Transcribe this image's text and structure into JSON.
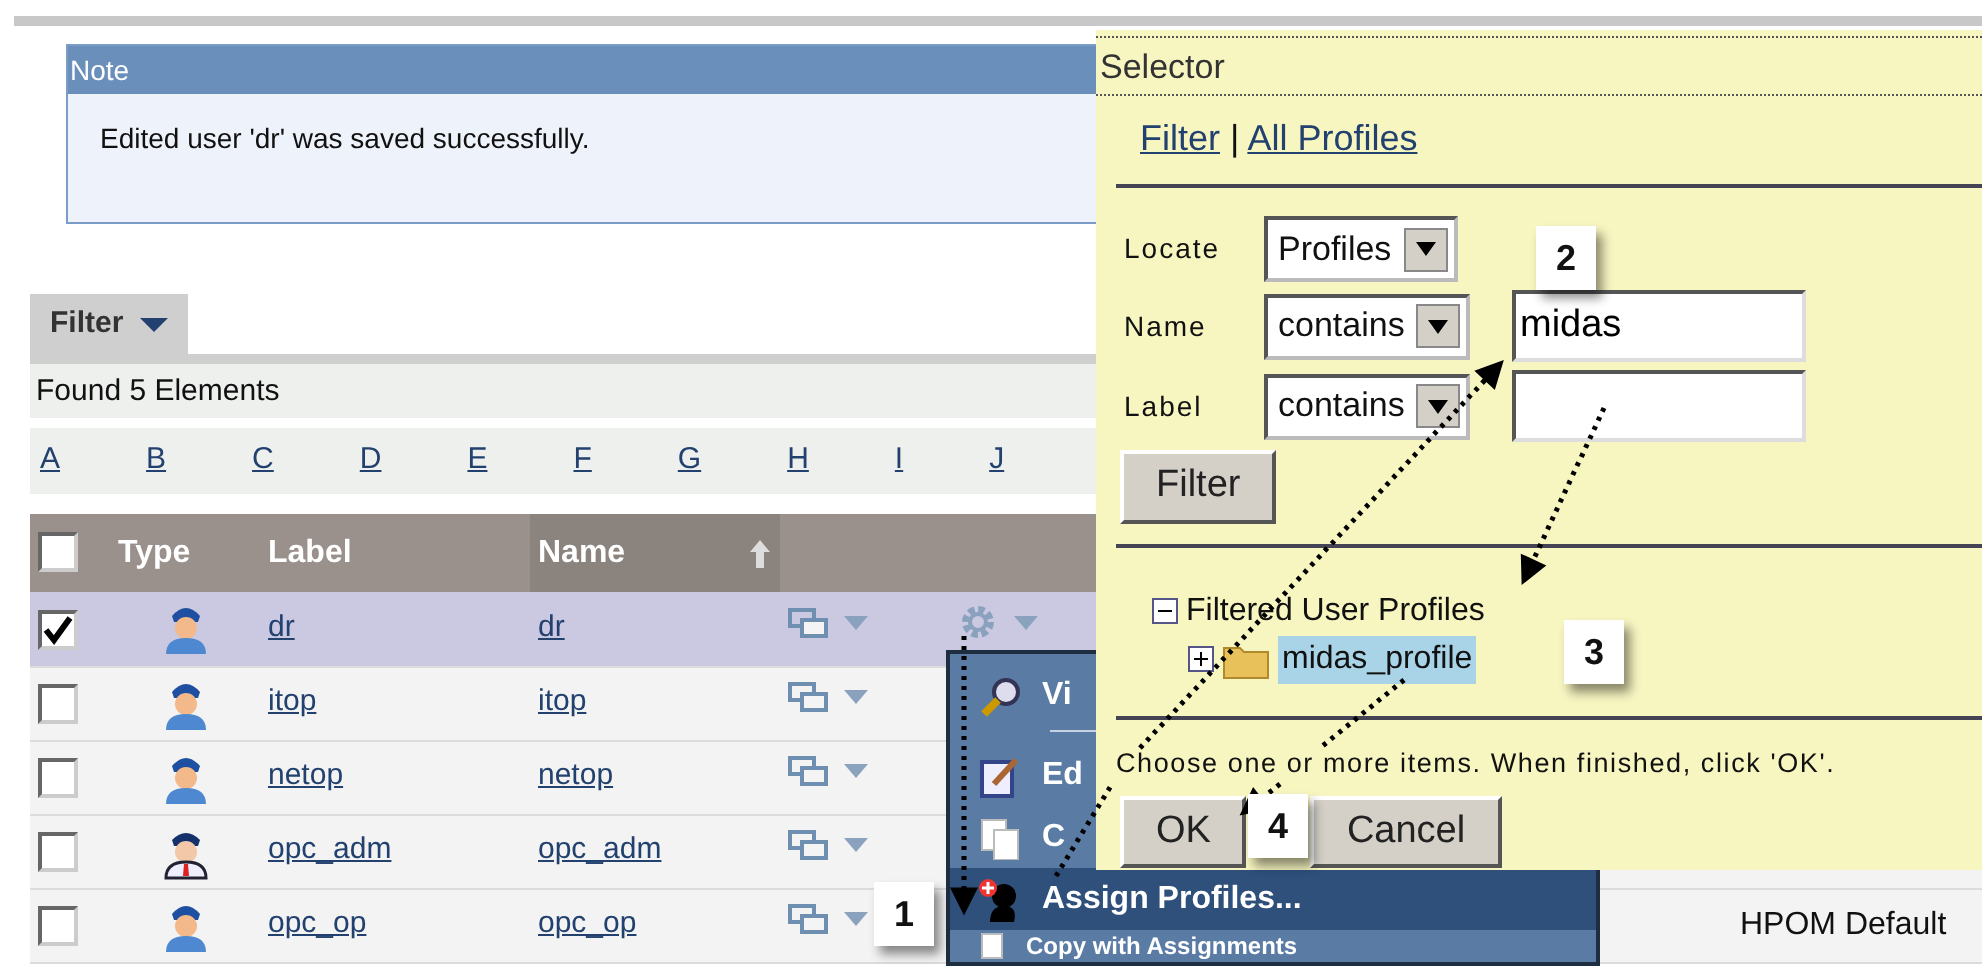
{
  "note": {
    "title": "Note",
    "message": "Edited user 'dr' was saved successfully."
  },
  "filter_tab": {
    "label": "Filter"
  },
  "found_text": "Found 5 Elements",
  "alphabet": [
    "A",
    "B",
    "C",
    "D",
    "E",
    "F",
    "G",
    "H",
    "I",
    "J"
  ],
  "table": {
    "select_all_checked": false,
    "columns": [
      "Type",
      "Label",
      "Name"
    ],
    "rows": [
      {
        "kind": "user",
        "label": "dr",
        "name": "dr",
        "checked": true,
        "selected": true,
        "gear": true
      },
      {
        "kind": "user",
        "label": "itop",
        "name": "itop",
        "checked": false,
        "selected": false
      },
      {
        "kind": "user",
        "label": "netop",
        "name": "netop",
        "checked": false,
        "selected": false
      },
      {
        "kind": "admin",
        "label": "opc_adm",
        "name": "opc_adm",
        "checked": false,
        "selected": false
      },
      {
        "kind": "user",
        "label": "opc_op",
        "name": "opc_op",
        "checked": false,
        "selected": false,
        "column_6": "HPOM Default"
      }
    ]
  },
  "context_menu": {
    "items": [
      {
        "kind": "view",
        "label": "Vi",
        "selected": false
      },
      {
        "kind": "edit",
        "label": "Ed",
        "selected": false
      },
      {
        "kind": "copy",
        "label": "C",
        "selected": false
      },
      {
        "kind": "assign",
        "label": "Assign Profiles...",
        "selected": true
      },
      {
        "kind": "copy_assign",
        "label": "Copy with Assignments",
        "selected": false
      }
    ]
  },
  "selector": {
    "title": "Selector",
    "links": [
      "Filter",
      "All Profiles"
    ],
    "link_separator": "|",
    "locate": {
      "label": "Locate",
      "value": "Profiles"
    },
    "name_filter": {
      "label": "Name",
      "operator": "contains",
      "value": "midas"
    },
    "label_filter": {
      "label": "Label",
      "operator": "contains"
    },
    "filter_button": "Filter",
    "tree": {
      "label": "Filtered User Profiles",
      "expanded": true,
      "children": [
        {
          "label": "midas_profile",
          "expanded": false,
          "selected": true
        }
      ]
    },
    "instruction": "Choose one or more items. When finished, click 'OK'.",
    "buttons": [
      "OK",
      "Cancel"
    ]
  },
  "callouts": [
    "1",
    "2",
    "3",
    "4"
  ]
}
